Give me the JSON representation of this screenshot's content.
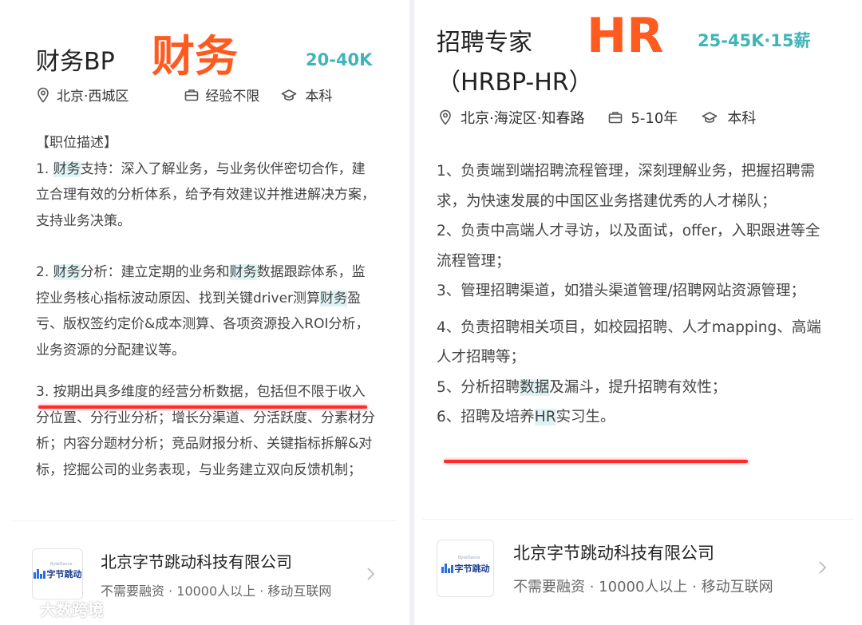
{
  "left": {
    "title": "财务BP",
    "tag": "财务",
    "salary": "20-40K",
    "location": "北京·西城区",
    "experience": "经验不限",
    "education": "本科",
    "section_heading": "【职位描述】",
    "items": [
      {
        "prefix": "1. ",
        "hl": "财务",
        "rest": "支持：深入了解业务，与业务伙伴密切合作，建立合理有效的分析体系，给予有效建议并推进解决方案，支持业务决策。"
      },
      {
        "prefix": "2. ",
        "hl": "财务",
        "mid1": "分析：建立定期的业务和",
        "hl2": "财务",
        "mid2": "数据跟踪体系，监控业务核心指标波动原因、找到关键driver测算",
        "hl3": "财务",
        "rest": "盈亏、版权签约定价&成本测算、各项资源投入ROI分析，业务资源的分配建议等。"
      },
      {
        "line1": "3. 按期出具多维度的经营分析数据，包括但不限于收",
        "rest": "入分位置、分行业分析；增长分渠道、分活跃度、分素材分析；内容分题材分析；竞品财报分析、关键指标拆解&对标，挖掘公司的业务表现，与业务建立双向反馈机制；"
      }
    ],
    "company": {
      "name": "北京字节跳动科技有限公司",
      "meta": "不需要融资 · 10000人以上 · 移动互联网",
      "logo_text": "字节跳动",
      "logo_small": "ByteDance"
    }
  },
  "right": {
    "title_line1": "招聘专家",
    "title_line2": "（HRBP-HR）",
    "tag": "HR",
    "salary": "25-45K·15薪",
    "location": "北京·海淀区·知春路",
    "experience": "5-10年",
    "education": "本科",
    "items": [
      "1、负责端到端招聘流程管理，深刻理解业务，把握招聘需求，为快速发展的中国区业务搭建优秀的人才梯队；",
      "2、负责中高端人才寻访，以及面试，offer，入职跟进等全流程管理；",
      "3、管理招聘渠道，如猎头渠道管理/招聘网站资源管理；",
      "4、负责招聘相关项目，如校园招聘、人才mapping、高端人才招聘等；"
    ],
    "item5": {
      "pre": "5、分析招聘",
      "hl": "数据",
      "rest": "及漏斗，提升招聘有效性；"
    },
    "item6": {
      "pre": "6、招聘及培养",
      "hl": "HR",
      "rest": "实习生。"
    },
    "company": {
      "name": "北京字节跳动科技有限公司",
      "meta": "不需要融资 · 10000人以上 · 移动互联网",
      "logo_text": "字节跳动",
      "logo_small": "ByteDance"
    }
  },
  "watermark": "大数跨境",
  "colors": {
    "accent_tag": "#ff5a1f",
    "salary": "#3fb5b9",
    "highlight": "#dff3f4",
    "underline": "#ff2b2b"
  }
}
